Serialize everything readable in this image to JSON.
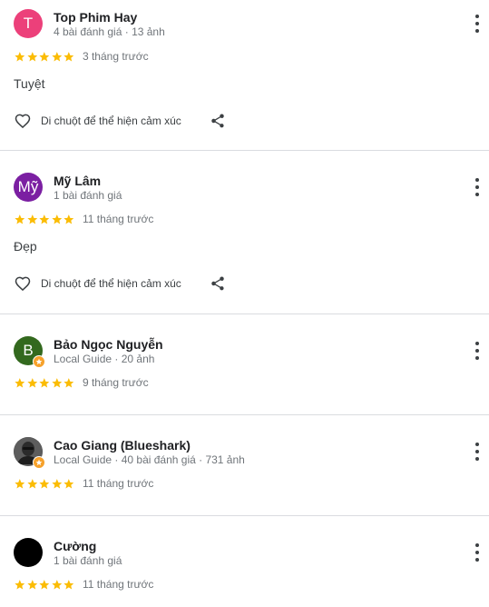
{
  "colors": {
    "star": "#fbbc04",
    "local_guide_badge": "#f6a12b"
  },
  "reviews": [
    {
      "name": "Top Phim Hay",
      "meta": "4 bài đánh giá · 13 ảnh",
      "avatar": {
        "letter": "T",
        "color": "#ec407a",
        "type": "letter"
      },
      "rating": 5,
      "time": "3 tháng trước",
      "text": "Tuyệt",
      "react_label": "Di chuột để thể hiện cảm xúc",
      "icons": {
        "heart": "heart-icon",
        "share": "share-icon",
        "more": "more-vert-icon"
      }
    },
    {
      "name": "Mỹ Lâm",
      "meta": "1 bài đánh giá",
      "avatar": {
        "letter": "Mỹ",
        "color": "#7b1fa2",
        "type": "letter"
      },
      "rating": 5,
      "time": "11 tháng trước",
      "text": "Đẹp",
      "react_label": "Di chuột để thể hiện cảm xúc"
    },
    {
      "name": "Bảo Ngọc Nguyễn",
      "meta": "Local Guide · 20 ảnh",
      "avatar": {
        "letter": "B",
        "color": "#33691e",
        "type": "letter",
        "local_guide": true
      },
      "rating": 5,
      "time": "9 tháng trước"
    },
    {
      "name": "Cao Giang (Blueshark)",
      "meta": "Local Guide · 40 bài đánh giá · 731 ảnh",
      "avatar": {
        "letter": "",
        "color": "#4e4e4e",
        "type": "photo",
        "local_guide": true
      },
      "rating": 5,
      "time": "11 tháng trước"
    },
    {
      "name": "Cường",
      "meta": "1 bài đánh giá",
      "avatar": {
        "letter": "",
        "color": "#000000",
        "type": "solid"
      },
      "rating": 5,
      "time": "11 tháng trước"
    }
  ]
}
